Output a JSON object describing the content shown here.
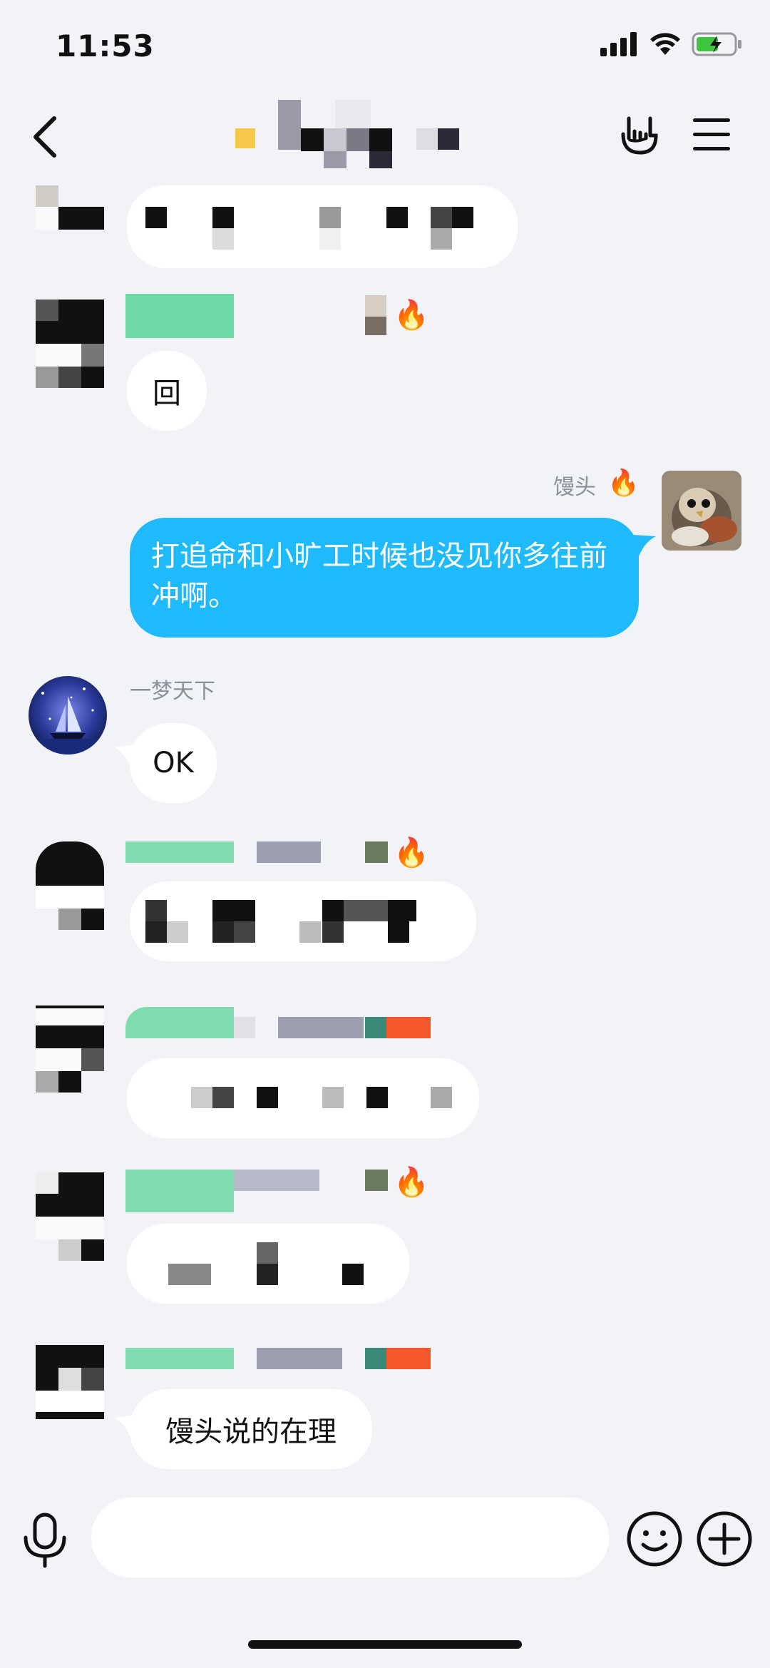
{
  "status_bar": {
    "time": "11:53"
  },
  "messages": {
    "reply_glyph": "回",
    "outgoing": {
      "sender": "馒头",
      "text": "打追命和小旷工时候也没见你多往前冲啊。"
    },
    "yimeng": {
      "sender": "一梦天下",
      "text": "OK"
    },
    "last": {
      "text": "馒头说的在理"
    }
  },
  "icons": {
    "back": "chevron-left-icon",
    "hand": "rock-hand-icon",
    "menu": "hamburger-menu-icon",
    "fire": "fire-icon",
    "mic": "microphone-icon",
    "emoji": "smiley-icon",
    "plus": "plus-circle-icon"
  },
  "colors": {
    "background": "#f2f3f7",
    "outgoing_bubble": "#1ebafc",
    "incoming_bubble": "#ffffff",
    "name_gray": "#8c8f99"
  }
}
